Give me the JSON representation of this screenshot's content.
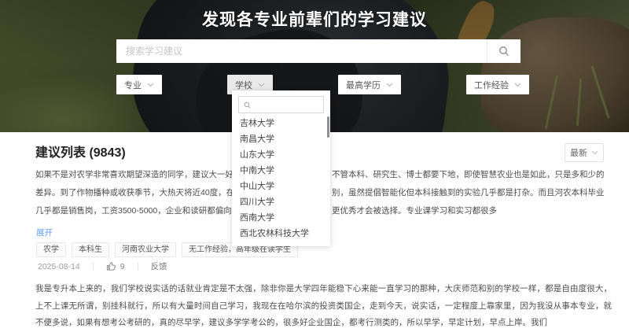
{
  "hero": {
    "title": "发现各专业前辈们的学习建议",
    "search_placeholder": "搜索学习建议",
    "filters": [
      {
        "label": "专业",
        "active": false
      },
      {
        "label": "学校",
        "active": true
      },
      {
        "label": "最高学历",
        "active": false
      },
      {
        "label": "工作经验",
        "active": false
      }
    ]
  },
  "school_dropdown": {
    "options": [
      "吉林大学",
      "南昌大学",
      "山东大学",
      "中南大学",
      "中山大学",
      "四川大学",
      "西南大学",
      "西北农林科技大学"
    ]
  },
  "list": {
    "header": "建议列表 (9843)",
    "sort_label": "最新"
  },
  "item1": {
    "lines": [
      {
        "left": "如果不是对农学非常喜欢期望深造的同学，建议大一好",
        "right": "不管本科、研究生、博士都要下地，即使智慧农业也是如此，只是多和少的"
      },
      {
        "left": "差异。到了作物播种或收获季节，大热天将近40度，在",
        "right": "别，虽然提倡智能化但本科接触到的实验几乎都是打杂。而且河农本科毕业"
      },
      {
        "left": "几乎都是销售岗，工资3500-5000，企业和读研都偏向",
        "right": "更优秀才会被选择。专业课学习和实习都很多"
      }
    ],
    "expand_label": "展开",
    "tags": [
      "农学",
      "本科生",
      "河南农业大学",
      "无工作经验，高年级在读学生"
    ],
    "date": "2025-08-14",
    "likes": "9",
    "feedback_label": "反馈"
  },
  "item2": {
    "text": "我是专升本上来的，我们学校说实话的话就业肯定是不太强，除非你是大学四年能稳下心来能一直学习的那种，大庆师范和别的学校一样，都是自由度很大，上不上课无所谓，别挂科就行，所以有大量时间自己学习，我现在在哈尔滨的投资类国企，走到今天，说实话，一定程度上靠家里，因为我没从事本专业，就不便多说，如果有想考公考研的，真的尽早学，建议多学学考公的，很多好企业国企，都考行测类的，所以早学，早定计划，早点上岸。我们"
  },
  "icons": {
    "search": "magnifier",
    "filter_chevron": "chevron-down",
    "likes": "thumbs-up"
  },
  "colors": {
    "accent_blue": "#5d9cf5",
    "active_filter_bg": "#e9e9e9"
  }
}
